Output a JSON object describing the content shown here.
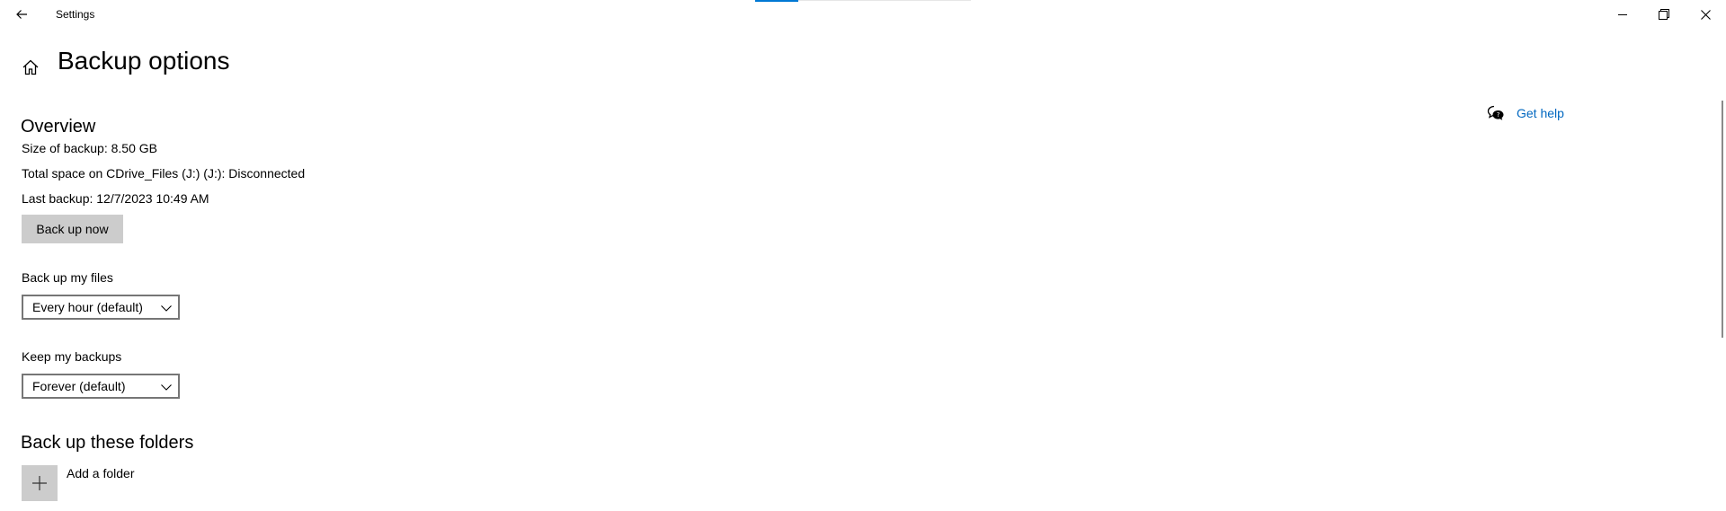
{
  "window": {
    "title": "Settings",
    "loading_progress": 0.2
  },
  "page": {
    "title": "Backup options"
  },
  "overview": {
    "heading": "Overview",
    "size_of_backup": "Size of backup: 8.50 GB",
    "total_space": "Total space on CDrive_Files (J:) (J:): Disconnected",
    "last_backup": "Last backup: 12/7/2023 10:49 AM",
    "back_up_now_label": "Back up now"
  },
  "backup_frequency": {
    "label": "Back up my files",
    "selected": "Every hour (default)"
  },
  "retention": {
    "label": "Keep my backups",
    "selected": "Forever (default)"
  },
  "folders": {
    "heading": "Back up these folders",
    "add_label": "Add a folder"
  },
  "help": {
    "link_text": "Get help"
  },
  "colors": {
    "accent": "#0078d4",
    "link": "#0067c0",
    "button_bg": "#cccccc"
  },
  "icons": [
    "back-arrow-icon",
    "home-icon",
    "minimize-icon",
    "maximize-icon",
    "close-icon",
    "chevron-down-icon",
    "plus-icon",
    "chat-help-icon"
  ]
}
